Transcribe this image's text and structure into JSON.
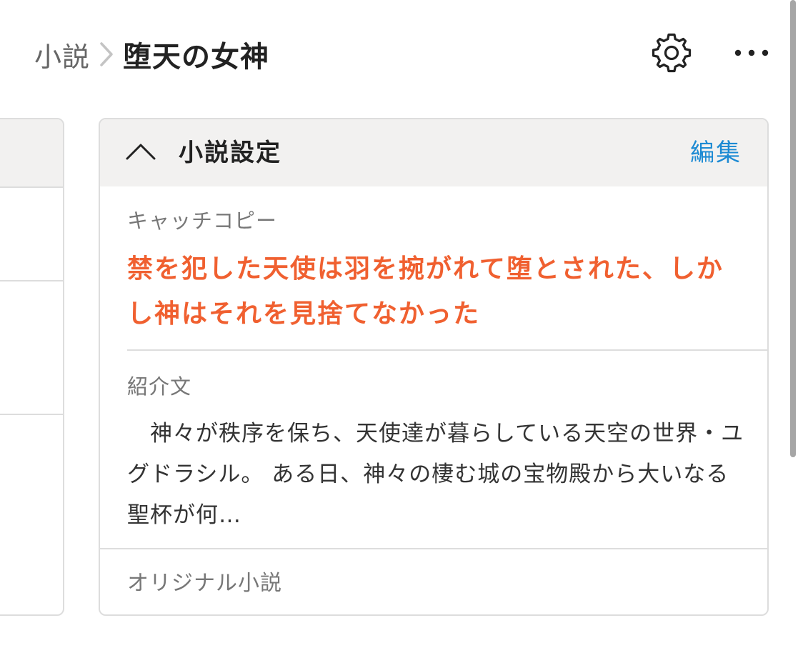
{
  "header": {
    "breadcrumb_parent": "小説",
    "breadcrumb_current": "堕天の女神",
    "separator_icon": "chevron-right-icon",
    "settings_icon": "gear-icon",
    "more_icon": "more-horizontal-icon"
  },
  "settings_panel": {
    "title": "小説設定",
    "collapse_icon": "chevron-up-icon",
    "edit_label": "編集",
    "catchcopy": {
      "label": "キャッチコピー",
      "text": "禁を犯した天使は羽を捥がれて堕とされた、しかし神はそれを見捨てなかった"
    },
    "introduction": {
      "label": "紹介文",
      "text": "　神々が秩序を保ち、天使達が暮らしている天空の世界・ユグドラシル。 ある日、神々の棲む城の宝物殿から大いなる聖杯が何…"
    },
    "origin": "オリジナル小説"
  },
  "colors": {
    "accent_orange": "#f06030",
    "link_blue": "#1c8ad3",
    "header_bg": "#f2f1f0",
    "border": "#dddddd"
  }
}
